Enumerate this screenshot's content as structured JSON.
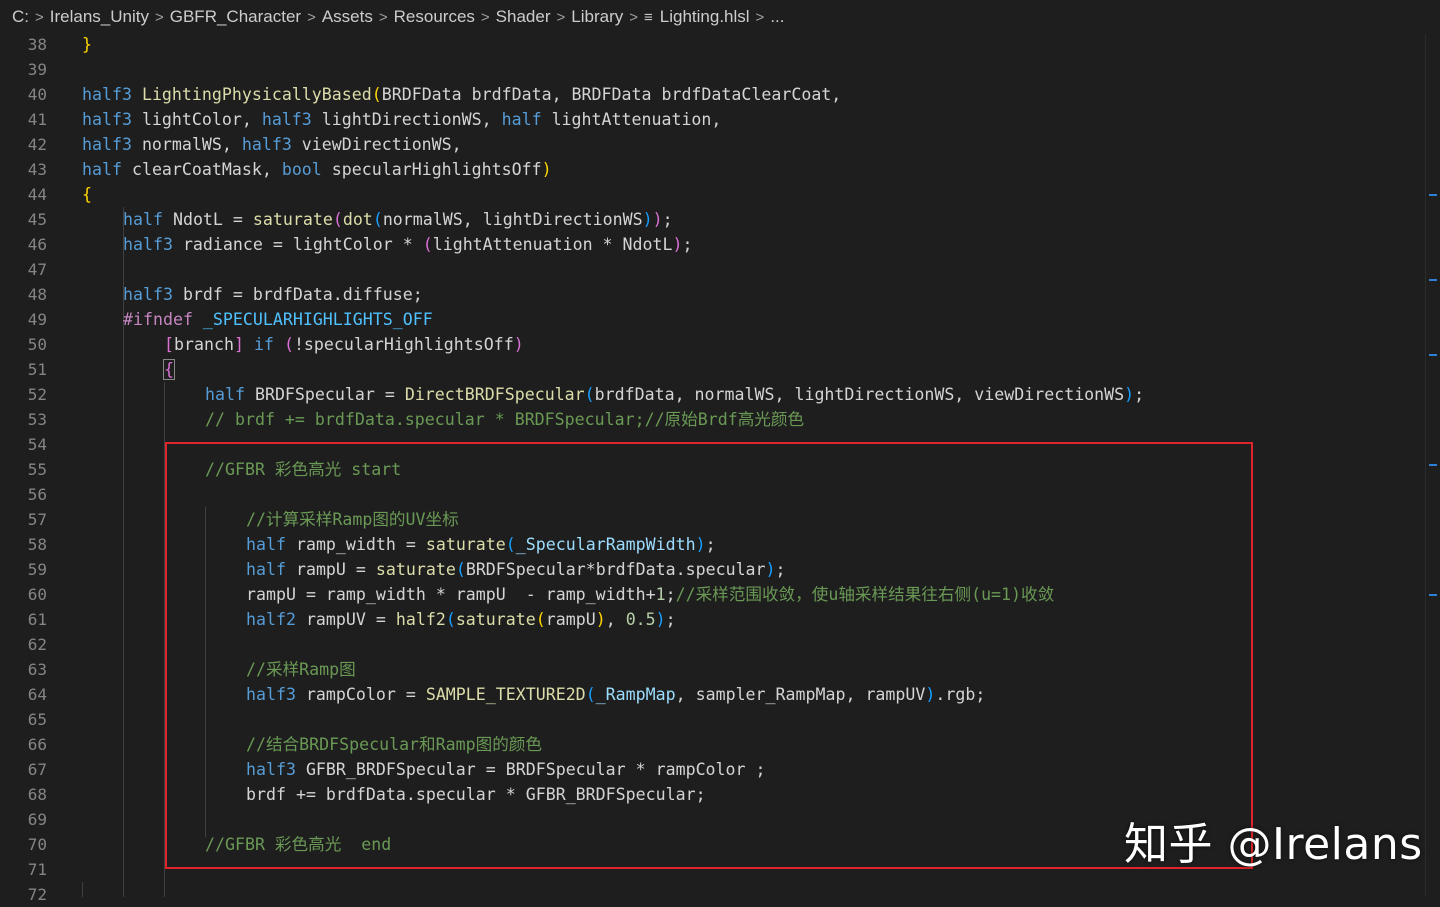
{
  "breadcrumb": {
    "items": [
      "C:",
      "Irelans_Unity",
      "GBFR_Character",
      "Assets",
      "Resources",
      "Shader",
      "Library"
    ],
    "file": "Lighting.hlsl",
    "more": "...",
    "separator": ">",
    "file_icon": "lines-icon"
  },
  "line_numbers": [
    "38",
    "39",
    "40",
    "41",
    "42",
    "43",
    "44",
    "45",
    "46",
    "47",
    "48",
    "49",
    "50",
    "51",
    "52",
    "53",
    "54",
    "55",
    "56",
    "57",
    "58",
    "59",
    "60",
    "61",
    "62",
    "63",
    "64",
    "65",
    "66",
    "67",
    "68",
    "69",
    "70",
    "71",
    "72"
  ],
  "code": {
    "l38_brace": "}",
    "l40_t1": "half3",
    "l40_fn": "LightingPhysicallyBased",
    "l40_p": "(",
    "l40_rest": "BRDFData brdfData, BRDFData brdfDataClearCoat,",
    "l41_t1": "half3",
    "l41_a": " lightColor, ",
    "l41_t2": "half3",
    "l41_b": " lightDirectionWS, ",
    "l41_t3": "half",
    "l41_c": " lightAttenuation,",
    "l42_t1": "half3",
    "l42_a": " normalWS, ",
    "l42_t2": "half3",
    "l42_b": " viewDirectionWS,",
    "l43_t1": "half",
    "l43_a": " clearCoatMask, ",
    "l43_t2": "bool",
    "l43_b": " specularHighlightsOff",
    "l43_p": ")",
    "l44_brace": "{",
    "l45_t": "half",
    "l45_a": " NdotL = ",
    "l45_f1": "saturate",
    "l45_p1": "(",
    "l45_f2": "dot",
    "l45_p2": "(",
    "l45_b": "normalWS, lightDirectionWS",
    "l45_p3": ")",
    "l45_p4": ")",
    "l45_c": ";",
    "l46_t": "half3",
    "l46_a": " radiance = lightColor * ",
    "l46_p1": "(",
    "l46_b": "lightAttenuation * NdotL",
    "l46_p2": ")",
    "l46_c": ";",
    "l48_t": "half3",
    "l48_a": " brdf = brdfData.diffuse;",
    "l49_pp": "#ifndef",
    "l49_mac": " _SPECULARHIGHLIGHTS_OFF",
    "l50_b1": "[",
    "l50_a": "branch",
    "l50_b2": "]",
    "l50_kw": " if",
    "l50_sp": " ",
    "l50_p1": "(",
    "l50_b": "!specularHighlightsOff",
    "l50_p2": ")",
    "l51_brace": "{",
    "l52_t": "half",
    "l52_a": " BRDFSpecular = ",
    "l52_f": "DirectBRDFSpecular",
    "l52_p1": "(",
    "l52_b": "brdfData, normalWS, lightDirectionWS, viewDirectionWS",
    "l52_p2": ")",
    "l52_c": ";",
    "l53_cm": "// brdf += brdfData.specular * BRDFSpecular;//原始Brdf高光颜色",
    "l55_cm": "//GFBR 彩色高光 start",
    "l57_cm": "//计算采样Ramp图的UV坐标",
    "l58_t": "half",
    "l58_a": " ramp_width = ",
    "l58_f": "saturate",
    "l58_p1": "(",
    "l58_v": "_SpecularRampWidth",
    "l58_p2": ")",
    "l58_c": ";",
    "l59_t": "half",
    "l59_a": " rampU = ",
    "l59_f": "saturate",
    "l59_p1": "(",
    "l59_b": "BRDFSpecular*brdfData.specular",
    "l59_p2": ")",
    "l59_c": ";",
    "l60_a": "rampU = ramp_width * rampU  - ramp_width+",
    "l60_n": "1",
    "l60_b": ";",
    "l60_cm": "//采样范围收敛，使u轴采样结果往右侧(u=1)收敛",
    "l61_t": "half2",
    "l61_a": " rampUV = ",
    "l61_f1": "half2",
    "l61_p1": "(",
    "l61_f2": "saturate",
    "l61_p2": "(",
    "l61_b": "rampU",
    "l61_p3": ")",
    "l61_c": ", ",
    "l61_n": "0.5",
    "l61_p4": ")",
    "l61_d": ";",
    "l63_cm": "//采样Ramp图",
    "l64_t": "half3",
    "l64_a": " rampColor = ",
    "l64_f": "SAMPLE_TEXTURE2D",
    "l64_p1": "(",
    "l64_v": "_RampMap",
    "l64_b": ", sampler_RampMap, rampUV",
    "l64_p2": ")",
    "l64_c": ".rgb;",
    "l66_cm": "//结合BRDFSpecular和Ramp图的颜色",
    "l67_t": "half3",
    "l67_a": " GFBR_BRDFSpecular = BRDFSpecular * rampColor ;",
    "l68_a": "brdf += brdfData.specular * GFBR_BRDFSpecular;",
    "l70_cm": "//GFBR 彩色高光  end"
  },
  "watermark": "知乎 @Irelans",
  "colors": {
    "background": "#1e1e1e",
    "keyword": "#569cd6",
    "function": "#dcdcaa",
    "comment": "#6a9955",
    "highlight_box": "#e0242b"
  }
}
